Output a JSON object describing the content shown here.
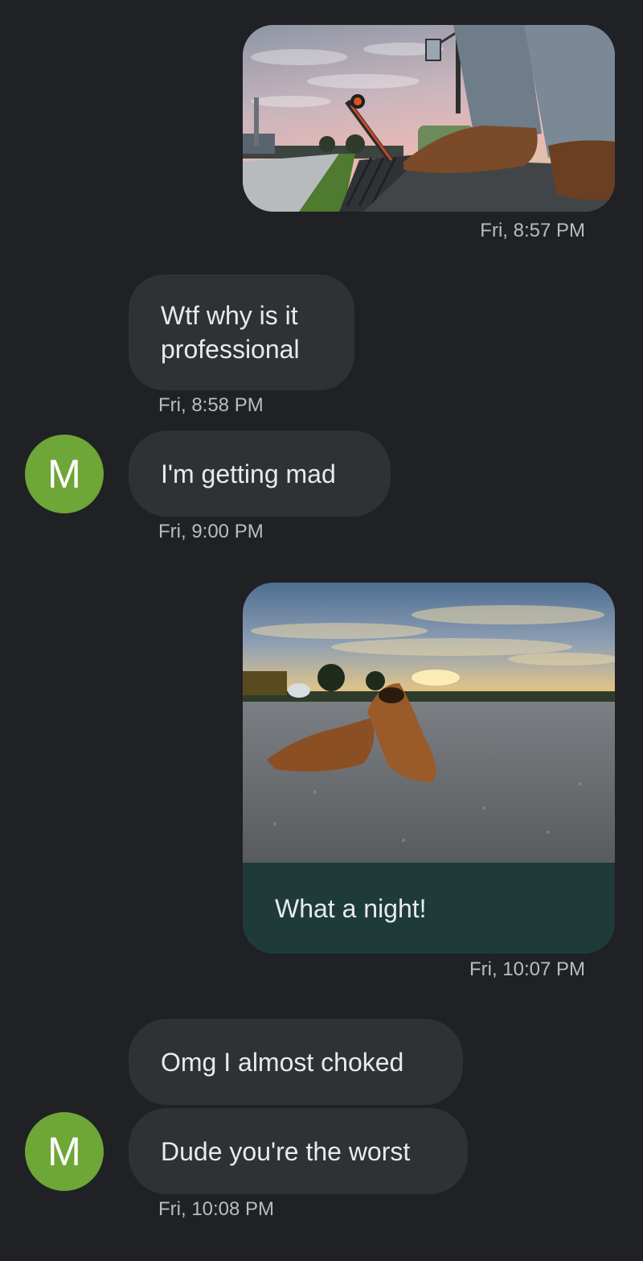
{
  "avatar_letter": "M",
  "colors": {
    "background": "#202124",
    "incoming_bubble": "#303134",
    "outgoing_caption": "#1e3b3a",
    "avatar": "#6ea638",
    "text": "#e8eaed",
    "timestamp": "#b9bcc1"
  },
  "messages": [
    {
      "direction": "outgoing",
      "type": "image",
      "image": "tractor-boots-photo",
      "timestamp": "Fri, 8:57 PM"
    },
    {
      "direction": "incoming",
      "type": "text",
      "text": "Wtf why is it professional",
      "timestamp": "Fri, 8:58 PM"
    },
    {
      "direction": "incoming",
      "type": "text",
      "text": "I'm getting mad",
      "timestamp": "Fri, 9:00 PM"
    },
    {
      "direction": "outgoing",
      "type": "image",
      "image": "dress-shoes-sunset-photo",
      "caption": "What a night!",
      "timestamp": "Fri, 10:07 PM"
    },
    {
      "direction": "incoming",
      "type": "text",
      "text": "Omg I almost choked"
    },
    {
      "direction": "incoming",
      "type": "text",
      "text": "Dude you're the worst",
      "timestamp": "Fri, 10:08 PM"
    }
  ]
}
